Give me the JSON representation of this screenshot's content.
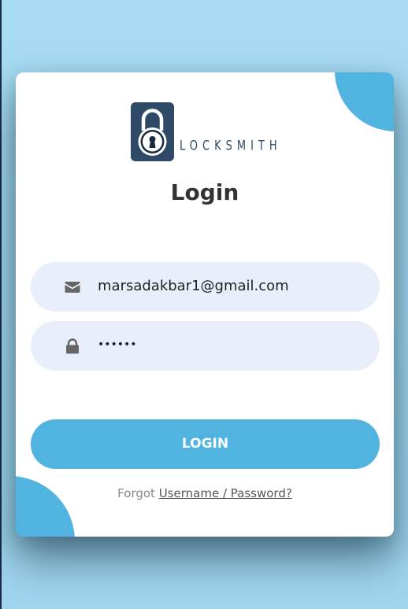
{
  "brand": {
    "name": "LOCKSMITH",
    "icon": "padlock-icon"
  },
  "login": {
    "title": "Login",
    "email_value": "marsadakbar1@gmail.com",
    "password_value": "••••••",
    "button_label": "LOGIN",
    "forgot_prefix": "Forgot",
    "forgot_link": "Username / Password?"
  },
  "icons": {
    "email": "envelope-icon",
    "password": "lock-icon"
  },
  "colors": {
    "accent": "#50b3e0",
    "background": "#a7dbf1",
    "field_bg": "#e8effb",
    "brand": "#2f4a66"
  }
}
